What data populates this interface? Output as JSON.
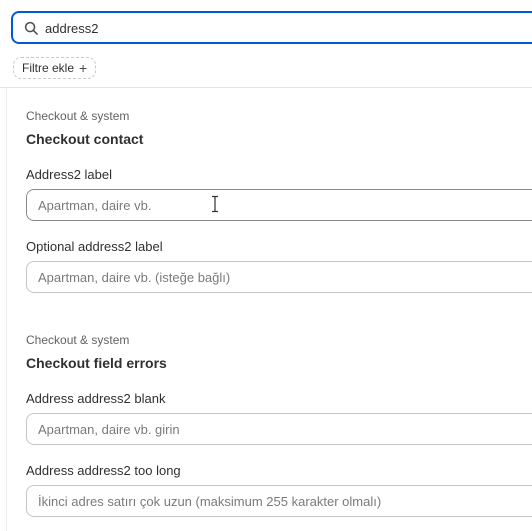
{
  "search": {
    "value": "address2",
    "icon": "search-icon"
  },
  "filter": {
    "label": "Filtre ekle",
    "icon": "plus-icon",
    "icon_glyph": "+"
  },
  "sections": [
    {
      "category": "Checkout & system",
      "title": "Checkout contact",
      "fields": [
        {
          "label": "Address2 label",
          "placeholder": "Apartman, daire vb.",
          "value": ""
        },
        {
          "label": "Optional address2 label",
          "placeholder": "Apartman, daire vb. (isteğe bağlı)",
          "value": ""
        }
      ]
    },
    {
      "category": "Checkout & system",
      "title": "Checkout field errors",
      "fields": [
        {
          "label": "Address address2 blank",
          "placeholder": "Apartman, daire vb. girin",
          "value": ""
        },
        {
          "label": "Address address2 too long",
          "placeholder": "İkinci adres satırı çok uzun (maksimum 255 karakter olmalı)",
          "value": ""
        }
      ]
    }
  ],
  "colors": {
    "focus_border": "#005bd3",
    "input_border": "#8a8a8a",
    "divider": "#e3e3e3"
  }
}
